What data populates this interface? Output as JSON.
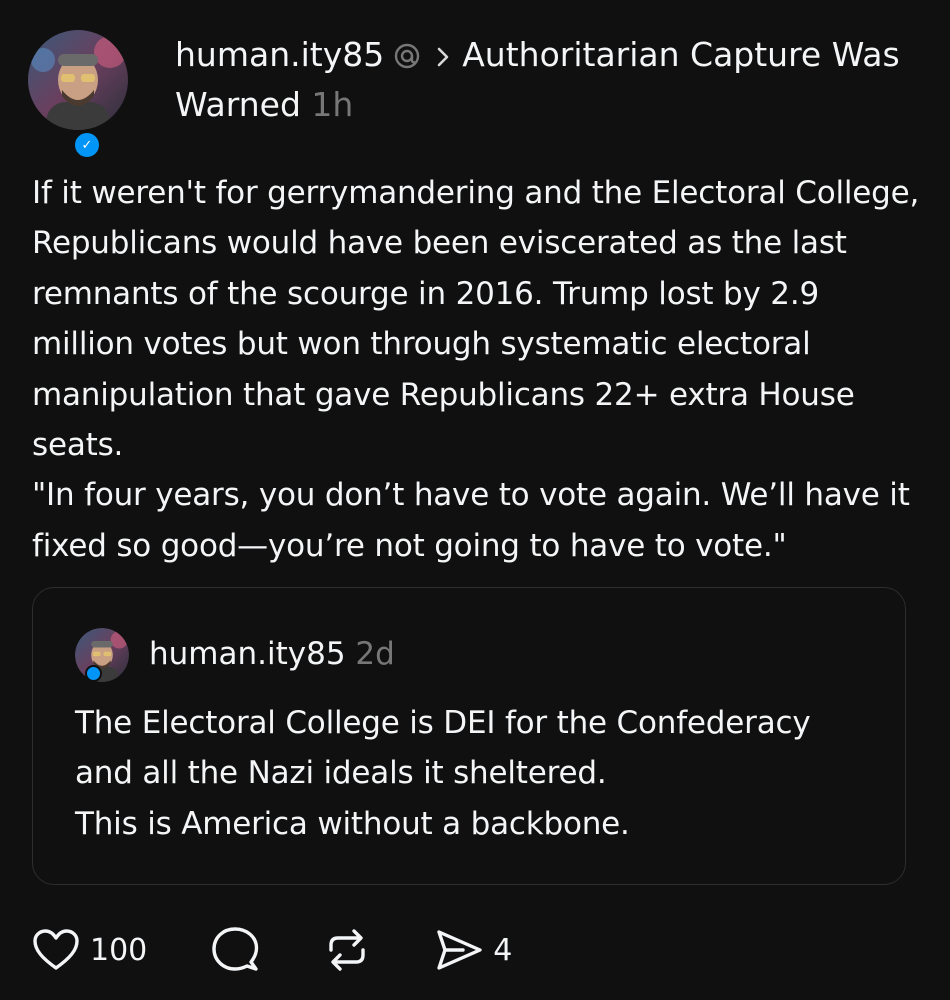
{
  "post": {
    "author": "human.ity85",
    "topic": "Authoritarian Capture Was Warned",
    "time": "1h",
    "body": "If it weren't for gerrymandering and the Electoral College, Republicans would have been eviscerated as the last remnants of the scourge in 2016. Trump lost by 2.9 million votes but won through systematic electoral manipulation that gave Republicans 22+ extra House seats.\n\"In four years, you don’t have to vote again. We’ll have it fixed so good—you’re not going to have to vote.\"",
    "verified_icon": "verified-check-icon",
    "threads_icon": "threads-logo-icon"
  },
  "quoted": {
    "author": "human.ity85",
    "time": "2d",
    "body": "The Electoral College is DEI for the Confederacy and all the Nazi ideals it sheltered.\nThis is America without a backbone."
  },
  "actions": {
    "like_count": "100",
    "share_count": "4",
    "icons": [
      "heart-icon",
      "comment-icon",
      "repost-icon",
      "share-icon"
    ]
  },
  "colors": {
    "background": "#101010",
    "text": "#f3f5f7",
    "muted": "#777777",
    "border": "#2d2d2d",
    "verified": "#0095f6"
  }
}
